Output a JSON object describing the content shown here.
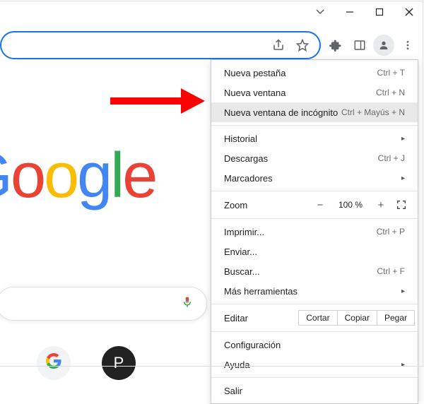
{
  "window": {
    "dropdown_symbol": "⌵",
    "minimize_title": "Minimize",
    "maximize_title": "Maximize",
    "close_title": "Close"
  },
  "toolbar": {
    "share_title": "Compartir",
    "star_title": "Marcador",
    "extensions_title": "Extensiones",
    "sidepanel_title": "Panel lateral",
    "profile_title": "Perfil",
    "menu_title": "Personaliza y controla Google Chrome"
  },
  "logo_text": {
    "g": "G",
    "o1": "o",
    "o2": "o",
    "gg": "g",
    "l": "l",
    "e": "e"
  },
  "shortcuts": [
    {
      "label": "G",
      "kind": "google"
    },
    {
      "label": "P",
      "kind": "dark"
    }
  ],
  "menu": {
    "new_tab": {
      "label": "Nueva pestaña",
      "shortcut": "Ctrl + T"
    },
    "new_window": {
      "label": "Nueva ventana",
      "shortcut": "Ctrl + N"
    },
    "incognito": {
      "label": "Nueva ventana de incógnito",
      "shortcut": "Ctrl + Mayús + N"
    },
    "history": {
      "label": "Historial"
    },
    "downloads": {
      "label": "Descargas",
      "shortcut": "Ctrl + J"
    },
    "bookmarks": {
      "label": "Marcadores"
    },
    "zoom": {
      "label": "Zoom",
      "minus": "−",
      "plus": "+",
      "value": "100 %"
    },
    "print": {
      "label": "Imprimir...",
      "shortcut": "Ctrl + P"
    },
    "send": {
      "label": "Enviar..."
    },
    "find": {
      "label": "Buscar...",
      "shortcut": "Ctrl + F"
    },
    "more_tools": {
      "label": "Más herramientas"
    },
    "edit": {
      "label": "Editar",
      "cut": "Cortar",
      "copy": "Copiar",
      "paste": "Pegar"
    },
    "settings": {
      "label": "Configuración"
    },
    "help": {
      "label": "Ayuda"
    },
    "exit": {
      "label": "Salir"
    }
  }
}
